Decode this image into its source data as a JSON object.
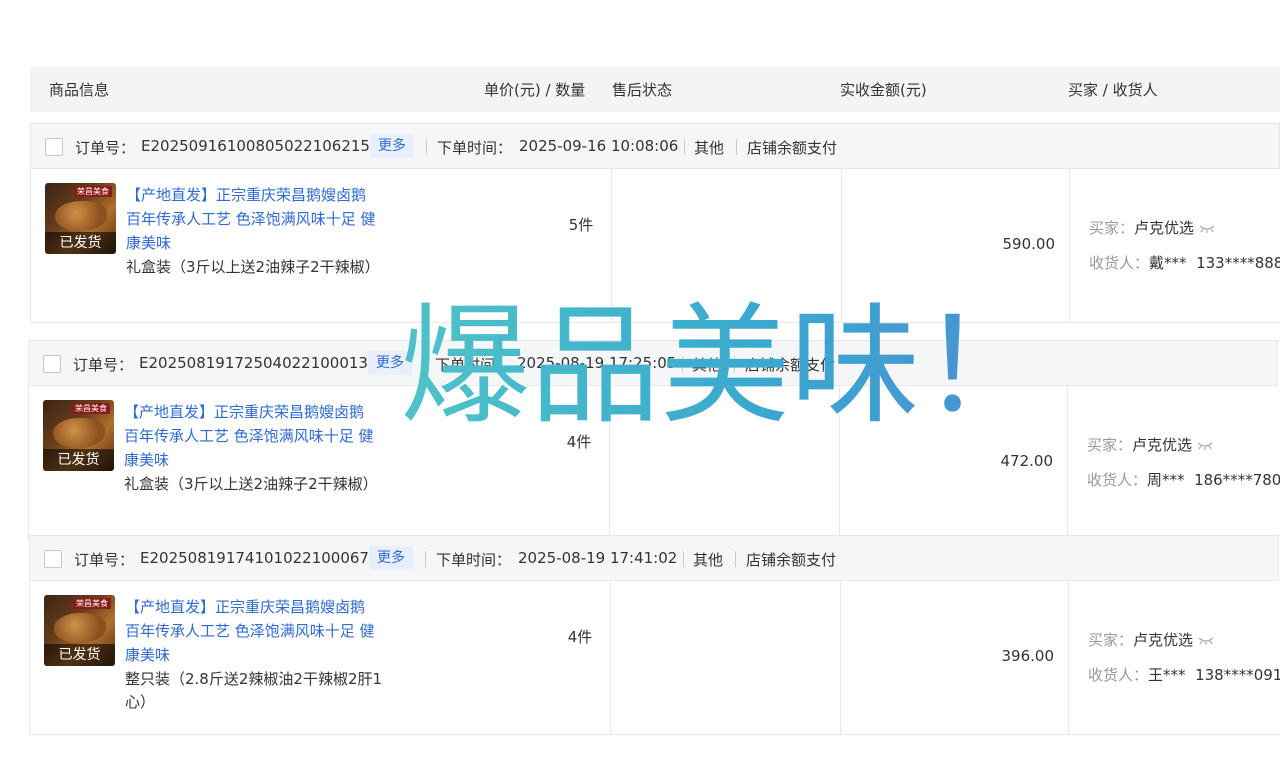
{
  "header": {
    "product_info": "商品信息",
    "price_qty": "单价(元) / 数量",
    "after_sale": "售后状态",
    "amount": "实收金额(元)",
    "buyer": "买家 / 收货人"
  },
  "labels": {
    "order_no": "订单号：",
    "more": "更多",
    "order_time": "下单时间：",
    "buyer": "买家：",
    "receiver": "收货人："
  },
  "orders": [
    {
      "order_no": "E20250916100805022106215",
      "time": "2025-09-16 10:08:06",
      "type": "其他",
      "payment": "店铺余额支付",
      "product_title": "【产地直发】正宗重庆荣昌鹅嫂卤鹅 百年传承人工艺 色泽饱满风味十足 健康美味",
      "spec": "礼盒装（3斤以上送2油辣子2干辣椒）",
      "status": "已发货",
      "quantity": "5件",
      "amount": "590.00",
      "buyer": "卢克优选",
      "receiver_name": "戴***",
      "receiver_phone": "133****888"
    },
    {
      "order_no": "E20250819172504022100013",
      "time": "2025-08-19 17:25:05",
      "type": "其他",
      "payment": "店铺余额支付",
      "product_title": "【产地直发】正宗重庆荣昌鹅嫂卤鹅 百年传承人工艺 色泽饱满风味十足 健康美味",
      "spec": "礼盒装（3斤以上送2油辣子2干辣椒）",
      "status": "已发货",
      "quantity": "4件",
      "amount": "472.00",
      "buyer": "卢克优选",
      "receiver_name": "周***",
      "receiver_phone": "186****780"
    },
    {
      "order_no": "E20250819174101022100067",
      "time": "2025-08-19 17:41:02",
      "type": "其他",
      "payment": "店铺余额支付",
      "product_title": "【产地直发】正宗重庆荣昌鹅嫂卤鹅 百年传承人工艺 色泽饱满风味十足 健康美味",
      "spec": "整只装（2.8斤送2辣椒油2干辣椒2肝1心）",
      "status": "已发货",
      "quantity": "4件",
      "amount": "396.00",
      "buyer": "卢克优选",
      "receiver_name": "王***",
      "receiver_phone": "138****091"
    }
  ],
  "thumb_brand": "荣昌美食",
  "watermark": "爆品美味！",
  "colors": {
    "link": "#2f6bd1",
    "header_bg": "#f3f4f6",
    "watermark_start": "#4fc3c8",
    "watermark_end": "#4a8fd4"
  }
}
